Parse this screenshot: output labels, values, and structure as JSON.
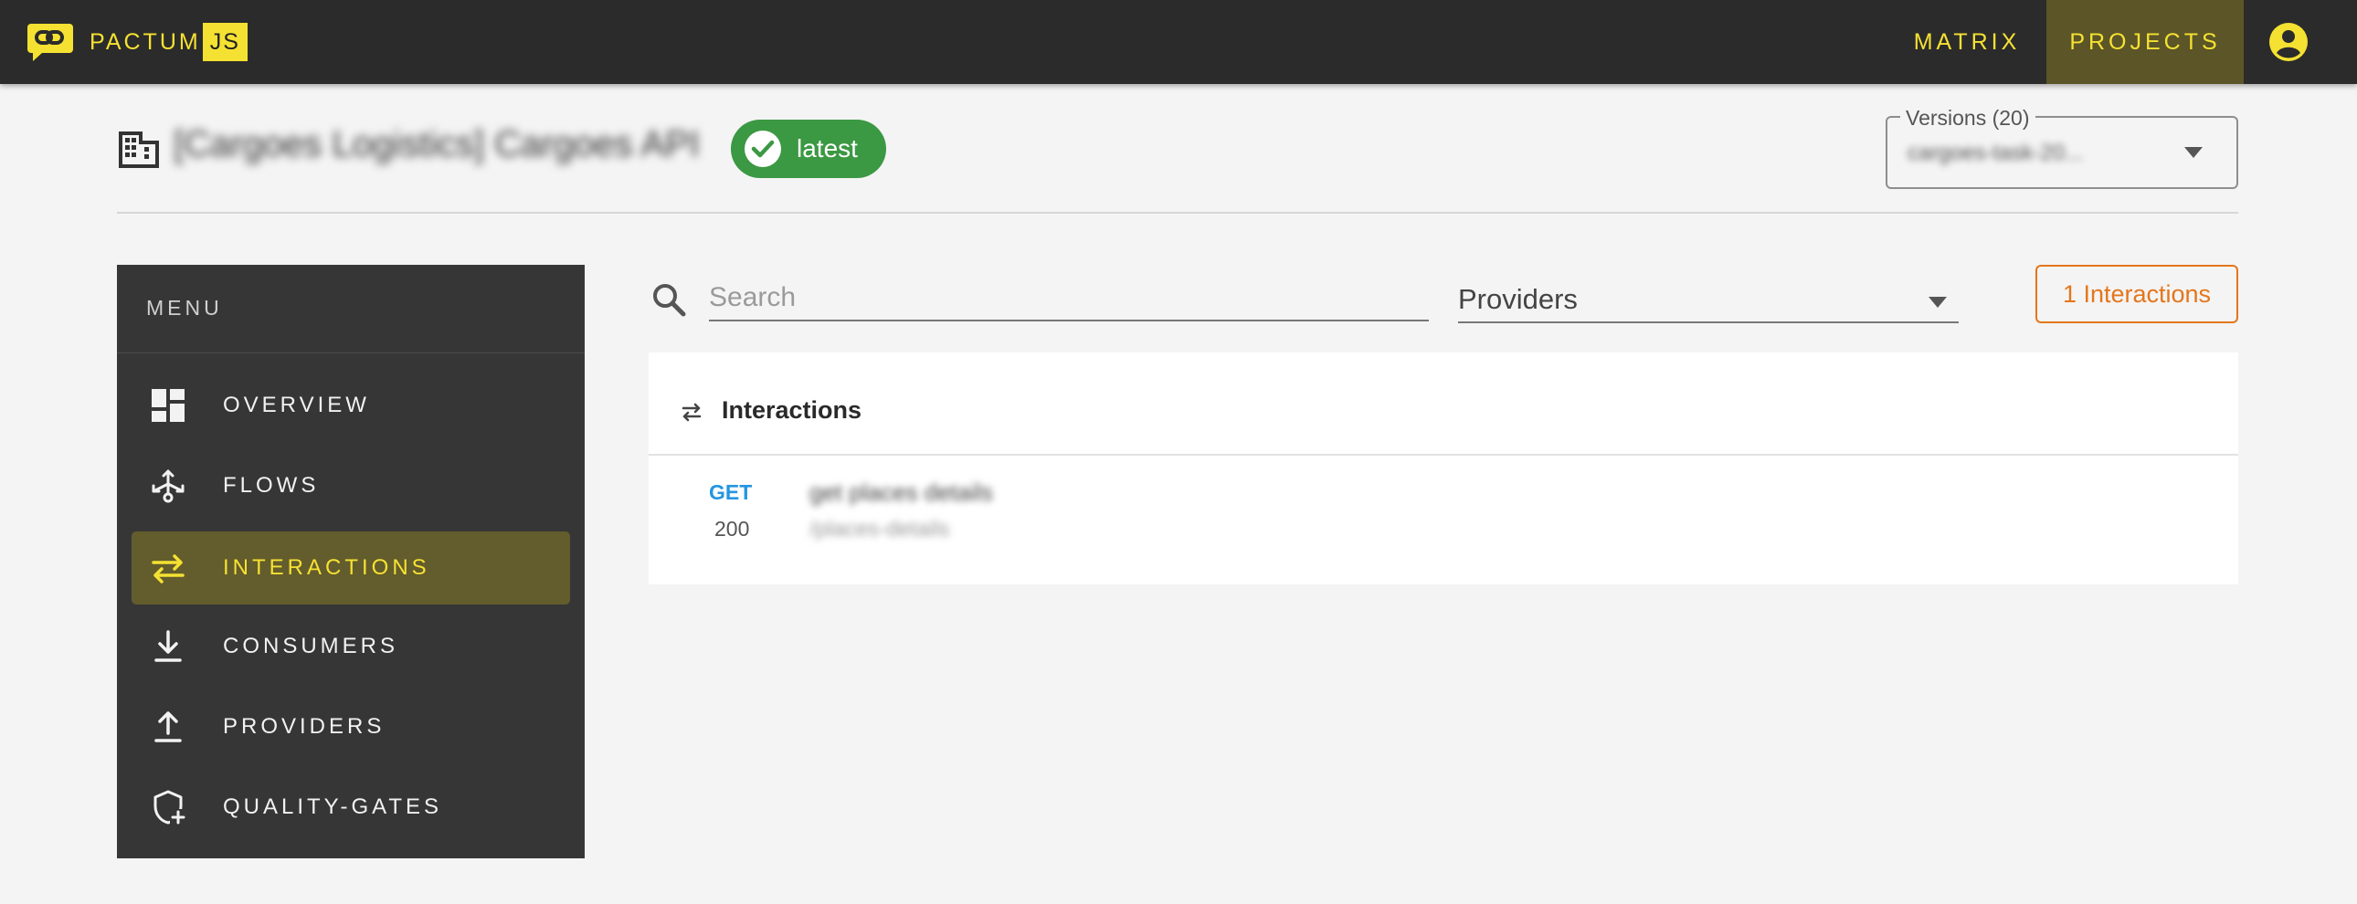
{
  "app": {
    "brand_name": "PACTUM",
    "brand_suffix": "JS",
    "accent_color": "#f5e132"
  },
  "nav": {
    "matrix_label": "MATRIX",
    "projects_label": "PROJECTS",
    "account_icon": "account-circle-icon"
  },
  "header": {
    "project_title": "[Cargoes Logistics] Cargoes API",
    "badge_label": "latest",
    "badge_color": "#3b9843",
    "versions_label": "Versions (20)",
    "versions_value": "cargoes-task-20..."
  },
  "sidebar": {
    "title": "MENU",
    "items": [
      {
        "label": "OVERVIEW",
        "icon": "dashboard-icon",
        "active": false
      },
      {
        "label": "FLOWS",
        "icon": "flows-icon",
        "active": false
      },
      {
        "label": "INTERACTIONS",
        "icon": "swap-arrows-icon",
        "active": true
      },
      {
        "label": "CONSUMERS",
        "icon": "download-icon",
        "active": false
      },
      {
        "label": "PROVIDERS",
        "icon": "upload-icon",
        "active": false
      },
      {
        "label": "QUALITY-GATES",
        "icon": "shield-plus-icon",
        "active": false
      }
    ]
  },
  "filters": {
    "search_placeholder": "Search",
    "providers_label": "Providers",
    "interactions_count_label": "1 Interactions",
    "count_color": "#e4761c"
  },
  "interactions": {
    "title": "Interactions",
    "rows": [
      {
        "method": "GET",
        "status": "200",
        "name": "get places details",
        "path": "/places-details"
      }
    ]
  }
}
